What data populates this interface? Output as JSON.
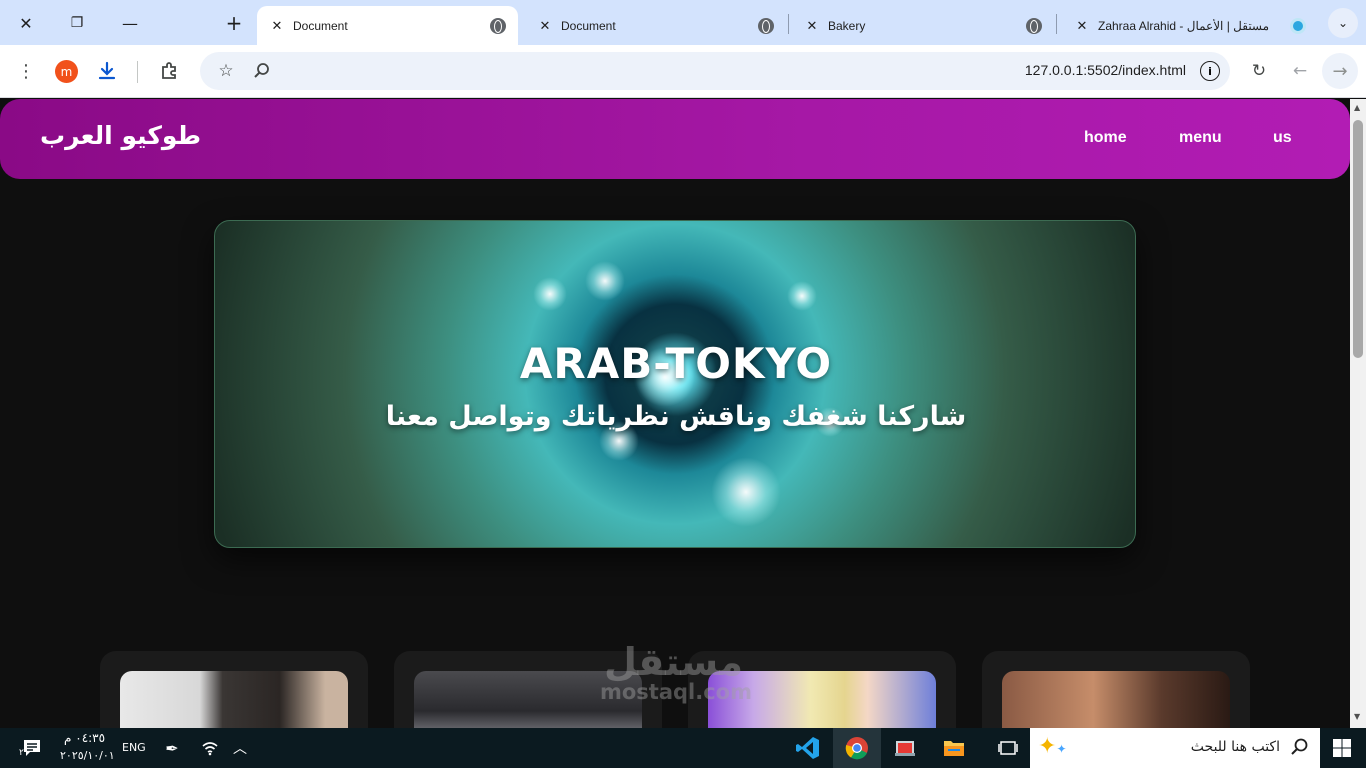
{
  "browser": {
    "window_controls": {
      "close": "✕",
      "restore": "❐",
      "minimize": "—",
      "new_tab": "+"
    },
    "tabs": [
      {
        "title": "Document",
        "active": true
      },
      {
        "title": "Document",
        "active": false
      },
      {
        "title": "Bakery",
        "active": false
      },
      {
        "title": "Zahraa Alrahid - مستقل | الأعمال",
        "active": false
      }
    ],
    "url": "127.0.0.1:5502/index.html",
    "profile_initial": "m"
  },
  "site": {
    "brand": "طوكيو العرب",
    "nav": [
      "home",
      "menu",
      "us"
    ],
    "hero": {
      "title": "ARAB-TOKYO",
      "subtitle": "شاركنا شغفك وناقش نظرياتك وتواصل معنا"
    }
  },
  "watermark": {
    "arabic": "مستقل",
    "latin": "mostaql.com"
  },
  "taskbar": {
    "time": "٠٤:٣٥ م",
    "date": "٢٠٢٥/١٠/٠١",
    "language": "ENG",
    "search_placeholder": "اكتب هنا للبحث",
    "notification_count": "٢"
  },
  "colors": {
    "nav_gradient_start": "#8a0a86",
    "nav_gradient_end": "#b21cb4",
    "page_bg": "#0f0f0f",
    "card_bg": "#1b1b1b",
    "tabbar_bg": "#d3e3fd"
  }
}
